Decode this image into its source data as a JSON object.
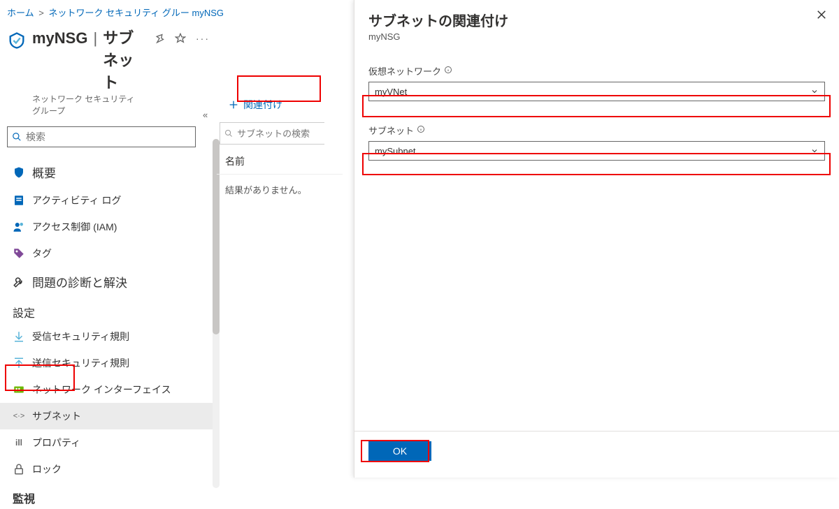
{
  "breadcrumb": {
    "home": "ホーム",
    "group": "ネットワーク セキュリティ グルー",
    "current": "myNSG"
  },
  "resource": {
    "name": "myNSG",
    "section": "サブネット",
    "type": "ネットワーク セキュリティ グループ"
  },
  "search": {
    "placeholder": "検索"
  },
  "nav": {
    "overview": "概要",
    "activity": "アクティビティ ログ",
    "iam": "アクセス制御 (IAM)",
    "tags": "タグ",
    "diagnose": "問題の診断と解決",
    "settings": "設定",
    "inbound": "受信セキュリティ規則",
    "outbound": "送信セキュリティ規則",
    "nic": "ネットワーク インターフェイス",
    "subnet": "サブネット",
    "properties": "プロパティ",
    "locks": "ロック",
    "monitor": "監視"
  },
  "mid": {
    "associate": "関連付け",
    "search_placeholder": "サブネットの検索",
    "col_name": "名前",
    "no_results": "結果がありません。"
  },
  "pane": {
    "title": "サブネットの関連付け",
    "sub": "myNSG",
    "vnet_label": "仮想ネットワーク",
    "vnet_value": "myVNet",
    "subnet_label": "サブネット",
    "subnet_value": "mySubnet",
    "ok": "OK"
  }
}
